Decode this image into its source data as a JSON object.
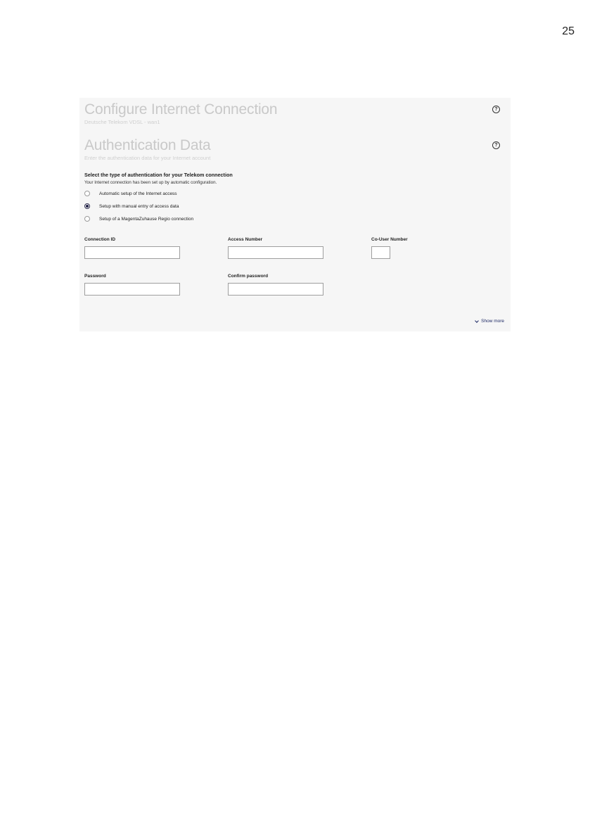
{
  "page_number": "25",
  "header": {
    "title": "Configure Internet Connection",
    "subtitle": "Deutsche Telekom VDSL - wan1",
    "help_icon": "help-circle-icon"
  },
  "auth": {
    "title": "Authentication Data",
    "subtitle": "Enter the authentication data for your Internet account",
    "help_icon": "help-circle-icon"
  },
  "auth_type": {
    "heading": "Select the type of authentication for your Telekom connection",
    "note": "Your Internet connection has been set up by automatic configuration.",
    "options": [
      {
        "label": "Automatic setup of the Internet access",
        "checked": false
      },
      {
        "label": "Setup with manual entry of access data",
        "checked": true
      },
      {
        "label": "Setup of a MagentaZuhause Regio connection",
        "checked": false
      }
    ],
    "selected": "Setup with manual entry of access data"
  },
  "fields": {
    "connection_id": {
      "label": "Connection ID",
      "value": ""
    },
    "access_number": {
      "label": "Access Number",
      "value": ""
    },
    "co_user_number": {
      "label": "Co-User Number",
      "value": ""
    },
    "password": {
      "label": "Password",
      "value": ""
    },
    "confirm_password": {
      "label": "Confirm password",
      "value": ""
    }
  },
  "show_more": {
    "label": "Show more",
    "icon": "chevron-down-icon"
  },
  "colors": {
    "panel_bg": "#f6f6f6",
    "title_gray": "#c9c9c9",
    "link_navy": "#1f2a66"
  }
}
